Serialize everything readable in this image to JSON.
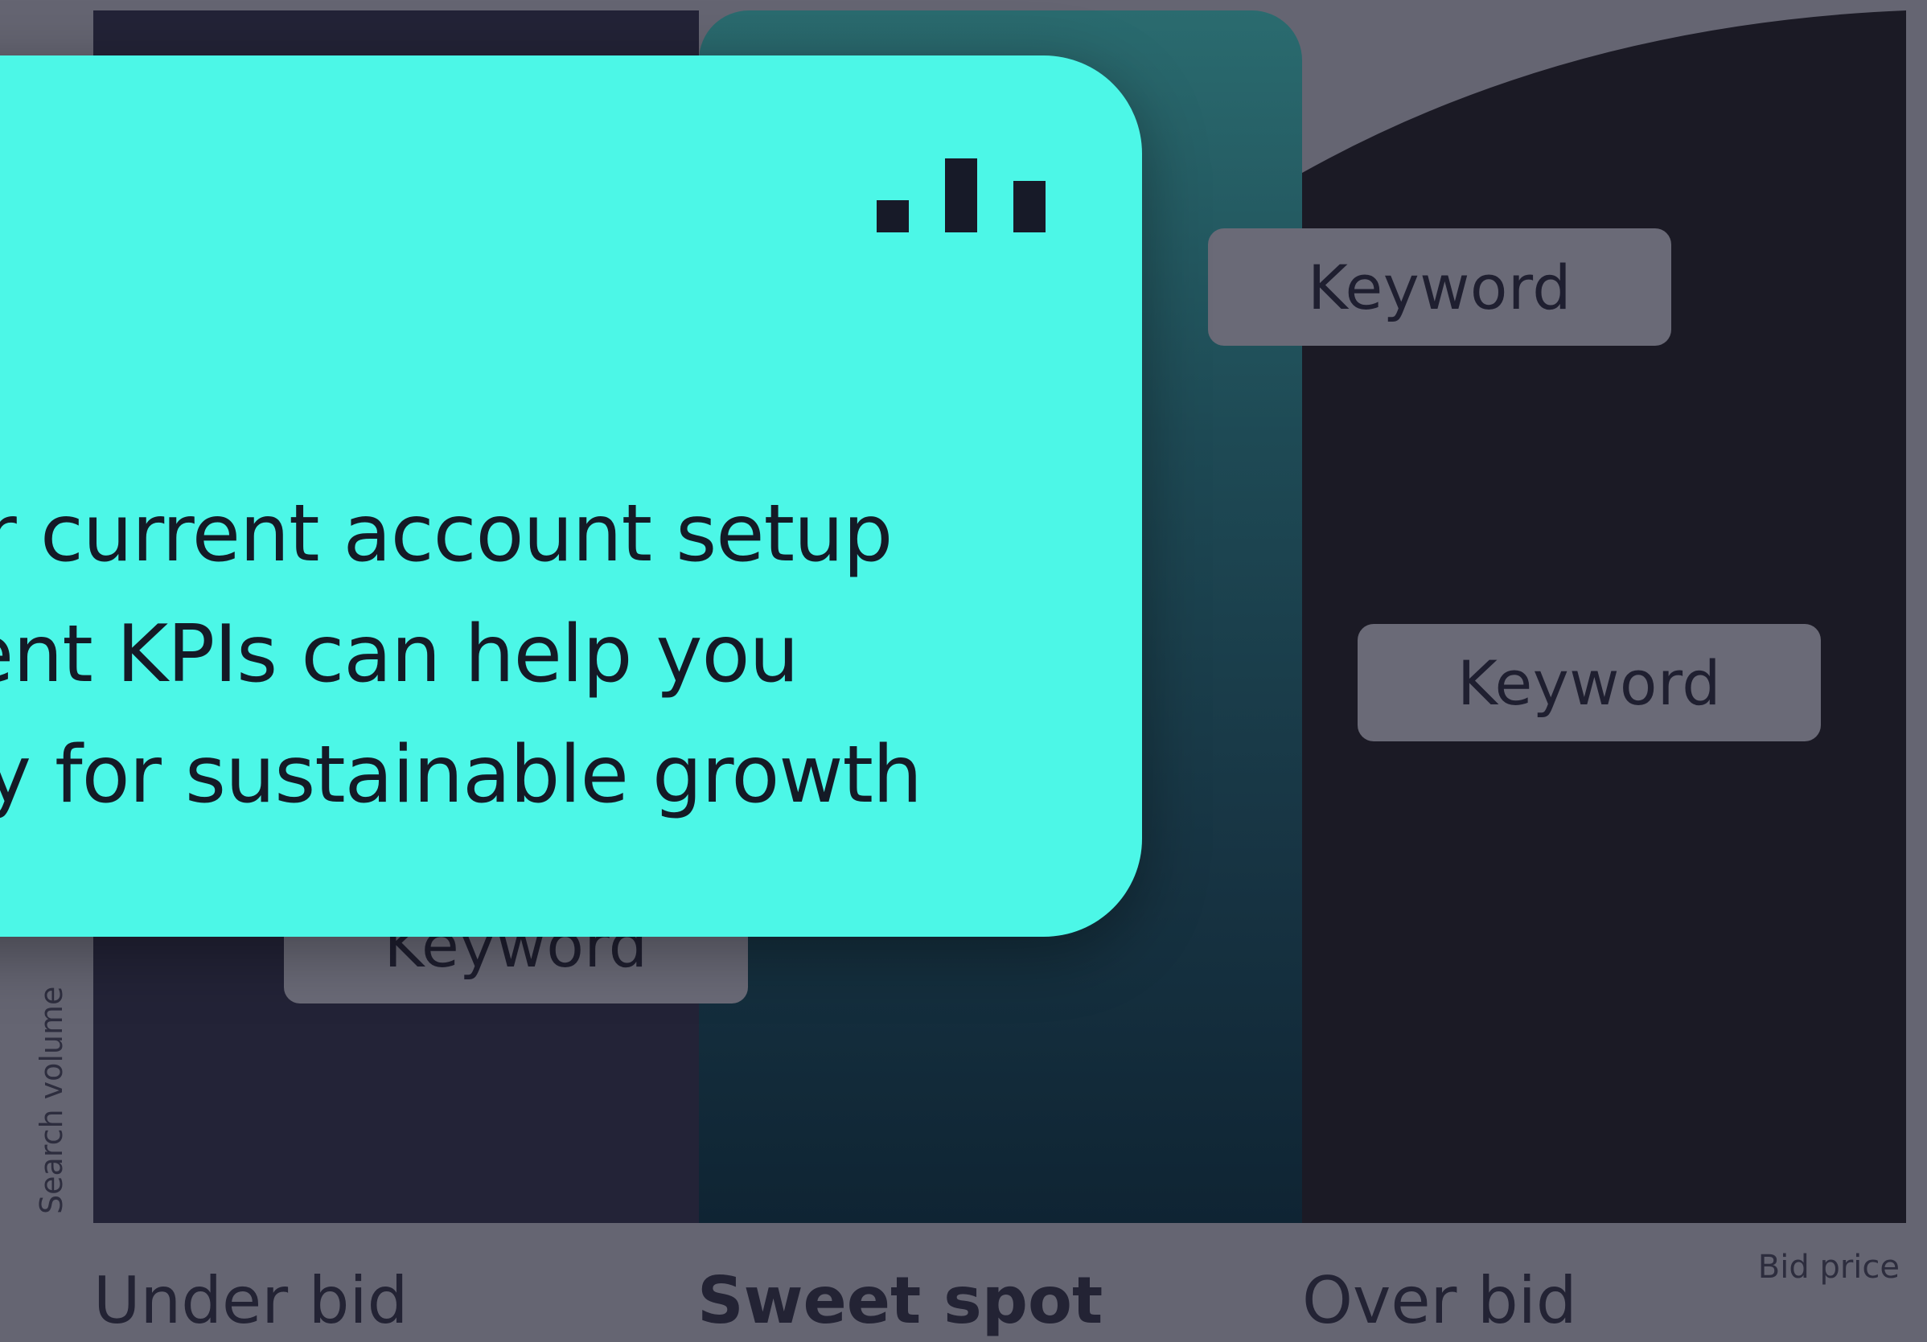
{
  "card": {
    "icon": "bar-chart-icon",
    "lines": [
      "our current account setup",
      "erent KPIs can help you",
      "egy for sustainable growth"
    ]
  },
  "keywords": [
    "Keyword",
    "Keyword",
    "Keyword"
  ],
  "zones": {
    "under": "Under bid",
    "sweet": "Sweet spot",
    "over": "Over bid"
  },
  "axes": {
    "y_label": "Search volume",
    "x_label": "Bid price"
  },
  "colors": {
    "background": "#656572",
    "card": "#4cf7e7",
    "under_zone": "#232337",
    "over_zone": "#1b1a25",
    "sweet_zone_top": "#2a6b6f",
    "sweet_zone_bottom": "#0f2433",
    "keyword_pill": "#6a6a77"
  }
}
